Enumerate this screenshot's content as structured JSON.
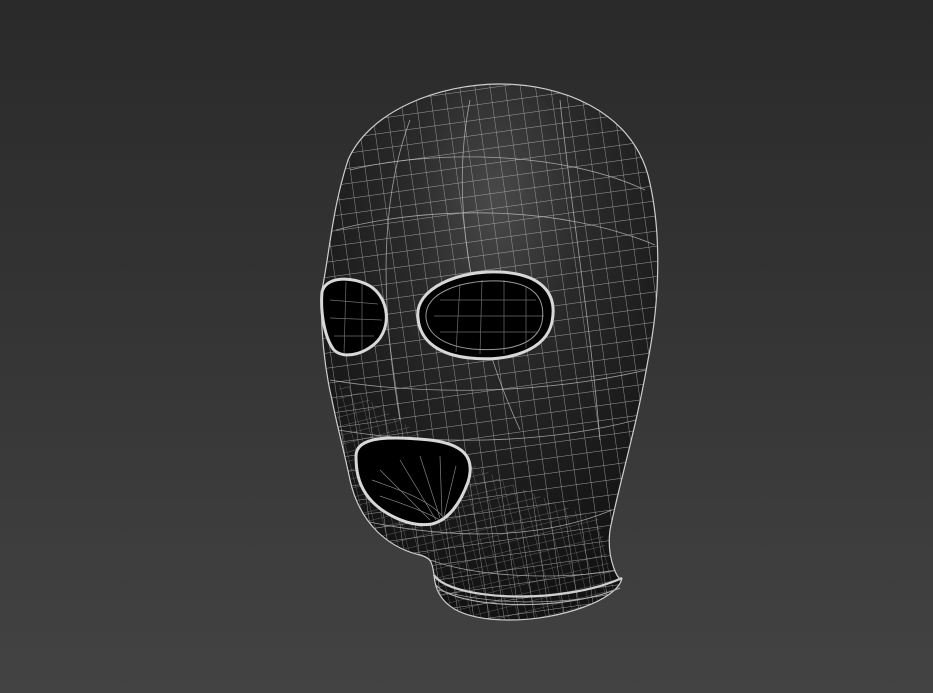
{
  "scene": {
    "subject_icon": "balaclava-mask-wireframe",
    "background_top_color": "#2a2a2a",
    "background_bottom_color": "#434343",
    "mesh_fill_color": "#161616",
    "mesh_highlight_color": "#4a4a4a",
    "wire_color": "#b8b8b8",
    "hole_color": "#000000"
  }
}
